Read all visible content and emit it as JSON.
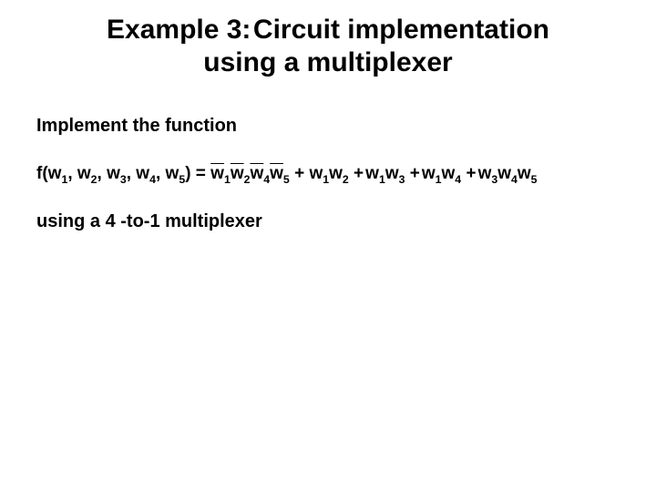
{
  "title_l1": "Example 3: Circuit implementation",
  "title_l2": "using a multiplexer",
  "line1": "Implement the function",
  "eq": {
    "lhs_pref": "f(w",
    "s1": "1",
    "c": ", w",
    "s2": "2",
    "s3": "3",
    "s4": "4",
    "s5": "5",
    "rparen_eq": ") = ",
    "w": "w",
    "plus": " + ",
    "plusS": " +",
    "sp": " "
  },
  "line3": "using a 4 -to-1 multiplexer"
}
